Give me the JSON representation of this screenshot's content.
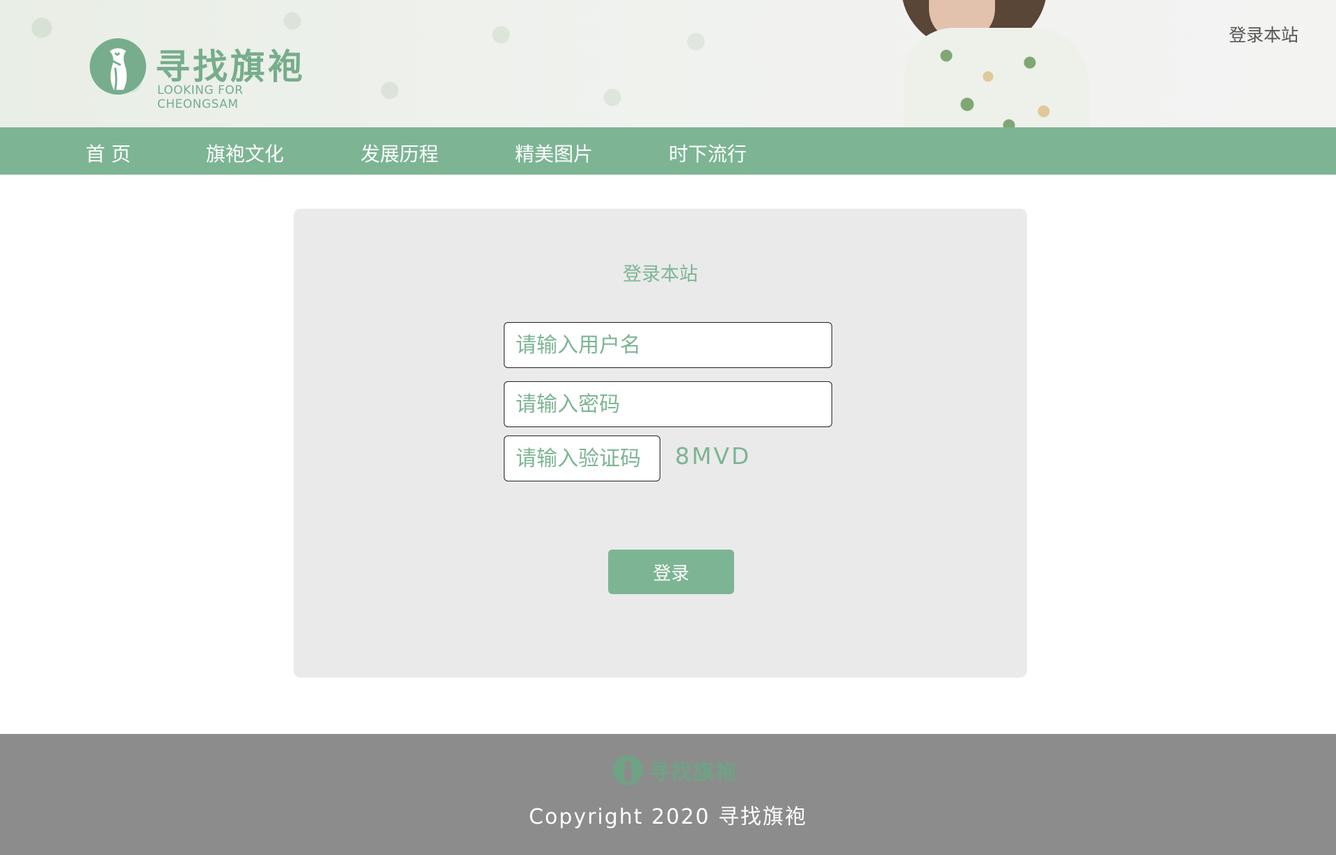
{
  "header": {
    "logo_cn": "寻找旗袍",
    "logo_en": "LOOKING FOR CHEONGSAM",
    "login_link": "登录本站"
  },
  "nav": {
    "items": [
      {
        "label": "首 页"
      },
      {
        "label": "旗袍文化"
      },
      {
        "label": "发展历程"
      },
      {
        "label": "精美图片"
      },
      {
        "label": "时下流行"
      }
    ]
  },
  "login": {
    "title": "登录本站",
    "username_placeholder": "请输入用户名",
    "password_placeholder": "请输入密码",
    "code_placeholder": "请输入验证码",
    "captcha": "8MVD",
    "submit_label": "登录"
  },
  "footer": {
    "logo_cn": "寻找旗袍",
    "copyright": "Copyright 2020 寻找旗袍"
  },
  "colors": {
    "accent": "#7db594",
    "nav_bg": "#7db594",
    "panel_bg": "#eaeaea",
    "footer_bg": "#8c8c8c"
  },
  "icons": {
    "logo": "cheongsam-logo-icon"
  }
}
